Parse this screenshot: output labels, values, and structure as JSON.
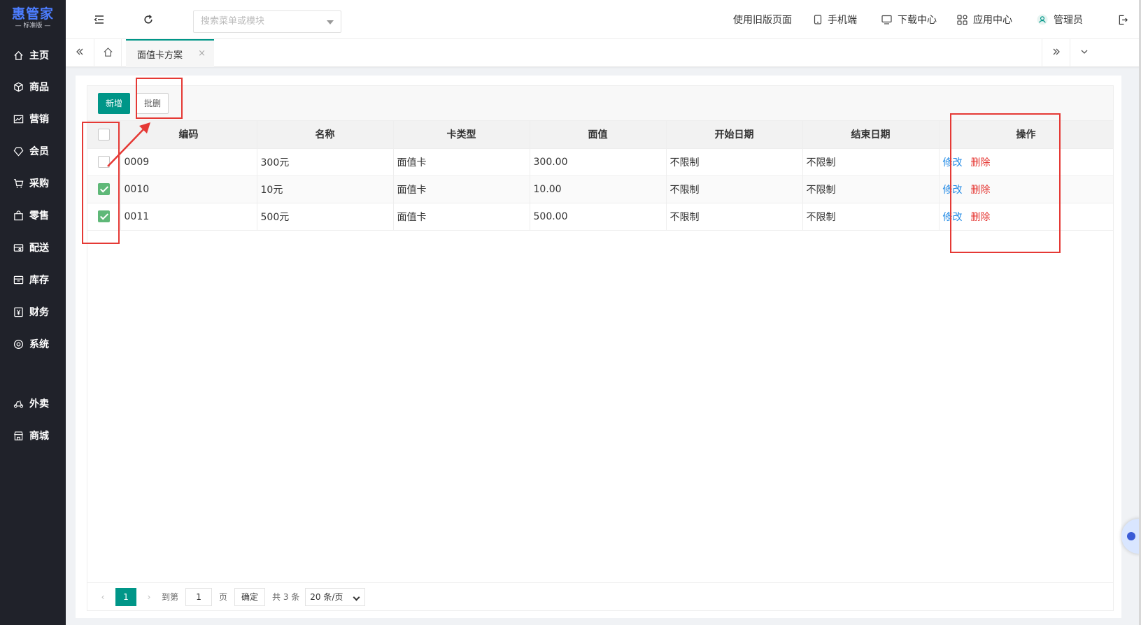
{
  "app": {
    "logo": "惠管家",
    "edition": "— 标准版 —"
  },
  "sidebar": {
    "items": [
      {
        "label": "主页",
        "icon": "home-icon"
      },
      {
        "label": "商品",
        "icon": "box-icon"
      },
      {
        "label": "营销",
        "icon": "chart-icon"
      },
      {
        "label": "会员",
        "icon": "diamond-icon"
      },
      {
        "label": "采购",
        "icon": "cart-icon"
      },
      {
        "label": "零售",
        "icon": "bag-icon"
      },
      {
        "label": "配送",
        "icon": "truck-icon"
      },
      {
        "label": "库存",
        "icon": "archive-icon"
      },
      {
        "label": "财务",
        "icon": "yen-icon"
      },
      {
        "label": "系统",
        "icon": "settings-icon"
      },
      {
        "label": "外卖",
        "icon": "scooter-icon"
      },
      {
        "label": "商城",
        "icon": "shop-icon"
      }
    ]
  },
  "topbar": {
    "search_placeholder": "搜索菜单或模块",
    "old_page": "使用旧版页面",
    "mobile": "手机端",
    "download": "下载中心",
    "apps": "应用中心",
    "user": "管理员"
  },
  "tabs": [
    {
      "label": "面值卡方案",
      "close": "×"
    }
  ],
  "toolbar": {
    "add": "新增",
    "batch_delete": "批删"
  },
  "table": {
    "columns": [
      "编码",
      "名称",
      "卡类型",
      "面值",
      "开始日期",
      "结束日期",
      "操作"
    ],
    "rows": [
      {
        "checked": false,
        "code": "0009",
        "name": "300元",
        "type": "面值卡",
        "value": "300.00",
        "start": "不限制",
        "end": "不限制"
      },
      {
        "checked": true,
        "code": "0010",
        "name": "10元",
        "type": "面值卡",
        "value": "10.00",
        "start": "不限制",
        "end": "不限制"
      },
      {
        "checked": true,
        "code": "0011",
        "name": "500元",
        "type": "面值卡",
        "value": "500.00",
        "start": "不限制",
        "end": "不限制"
      }
    ],
    "edit": "修改",
    "delete": "删除"
  },
  "pager": {
    "current": "1",
    "goto": "到第",
    "page_input": "1",
    "page_unit": "页",
    "confirm": "确定",
    "total": "共 3 条",
    "per_page": "20 条/页"
  },
  "colors": {
    "primary": "#009688",
    "check": "#5fb878",
    "link": "#1e88e5",
    "danger": "#e53935",
    "sidebar": "#20222a",
    "annotation": "#e53935"
  }
}
